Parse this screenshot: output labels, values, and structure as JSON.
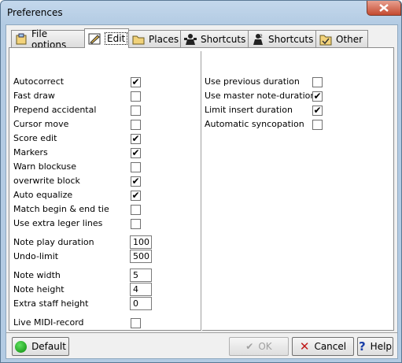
{
  "window": {
    "title": "Preferences"
  },
  "tabs": [
    {
      "label": "File options",
      "icon": "file-options-icon"
    },
    {
      "label": "Edit",
      "icon": "edit-icon"
    },
    {
      "label": "Places",
      "icon": "folder-icon"
    },
    {
      "label": "Shortcuts",
      "icon": "shortcuts-person-icon"
    },
    {
      "label": "Shortcuts",
      "icon": "shortcuts-person-2-icon"
    },
    {
      "label": "Other",
      "icon": "other-folder-icon"
    }
  ],
  "left_checks": [
    {
      "label": "Autocorrect",
      "checked": true
    },
    {
      "label": "Fast draw",
      "checked": false
    },
    {
      "label": "Prepend accidental",
      "checked": false
    },
    {
      "label": "Cursor move",
      "checked": false
    },
    {
      "label": "Score edit",
      "checked": true
    },
    {
      "label": "Markers",
      "checked": true
    },
    {
      "label": "Warn blockuse",
      "checked": false
    },
    {
      "label": "overwrite block",
      "checked": true
    },
    {
      "label": "Auto equalize",
      "checked": true
    },
    {
      "label": "Match begin & end tie",
      "checked": false
    },
    {
      "label": "Use extra leger lines",
      "checked": false
    }
  ],
  "fields": [
    {
      "label": "Note play duration",
      "value": "100"
    },
    {
      "label": "Undo-limit",
      "value": "500"
    },
    {
      "label": "Note width",
      "value": "5"
    },
    {
      "label": "Note height",
      "value": "4"
    },
    {
      "label": "Extra staff height",
      "value": "0"
    }
  ],
  "live_midi": {
    "label": "Live MIDI-record",
    "checked": false
  },
  "right_checks": [
    {
      "label": "Use previous duration",
      "checked": false
    },
    {
      "label": "Use master note-duration",
      "checked": true
    },
    {
      "label": "Limit insert duration",
      "checked": true
    },
    {
      "label": "Automatic syncopation",
      "checked": false
    }
  ],
  "buttons": {
    "default": "Default",
    "ok": "OK",
    "cancel": "Cancel",
    "help": "Help"
  },
  "check_glyph": "✔"
}
